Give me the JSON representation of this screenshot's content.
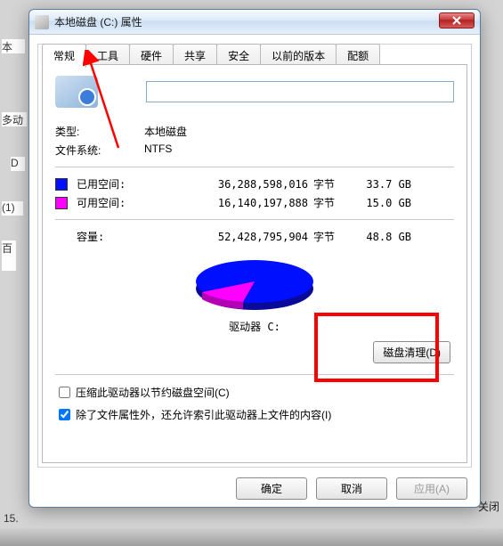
{
  "titlebar": {
    "title": "本地磁盘 (C:) 属性"
  },
  "tabs": [
    "常规",
    "工具",
    "硬件",
    "共享",
    "安全",
    "以前的版本",
    "配额"
  ],
  "active_tab_index": 0,
  "general": {
    "name_value": "",
    "type_label": "类型:",
    "type_value": "本地磁盘",
    "fs_label": "文件系统:",
    "fs_value": "NTFS",
    "used_label": "已用空间:",
    "used_bytes": "36,288,598,016",
    "used_unit": "字节",
    "used_gb": "33.7 GB",
    "free_label": "可用空间:",
    "free_bytes": "16,140,197,888",
    "free_unit": "字节",
    "free_gb": "15.0 GB",
    "cap_label": "容量:",
    "cap_bytes": "52,428,795,904",
    "cap_unit": "字节",
    "cap_gb": "48.8 GB",
    "drive_label": "驱动器 C:",
    "disk_cleanup": "磁盘清理(D)",
    "compress_label": "压缩此驱动器以节约磁盘空间(C)",
    "compress_checked": false,
    "index_label": "除了文件属性外，还允许索引此驱动器上文件的内容(I)",
    "index_checked": true
  },
  "footer": {
    "ok": "确定",
    "cancel": "取消",
    "apply": "应用(A)"
  },
  "background": {
    "close_text": "关闭",
    "num_text": "15."
  },
  "chart_data": {
    "type": "pie",
    "title": "驱动器 C:",
    "categories": [
      "已用空间",
      "可用空间"
    ],
    "values": [
      36288598016,
      16140197888
    ],
    "series": [
      {
        "name": "已用空间",
        "value": 33.7,
        "unit": "GB",
        "color": "#0010ff"
      },
      {
        "name": "可用空间",
        "value": 15.0,
        "unit": "GB",
        "color": "#ff00ff"
      }
    ],
    "total": {
      "value": 48.8,
      "unit": "GB"
    }
  }
}
